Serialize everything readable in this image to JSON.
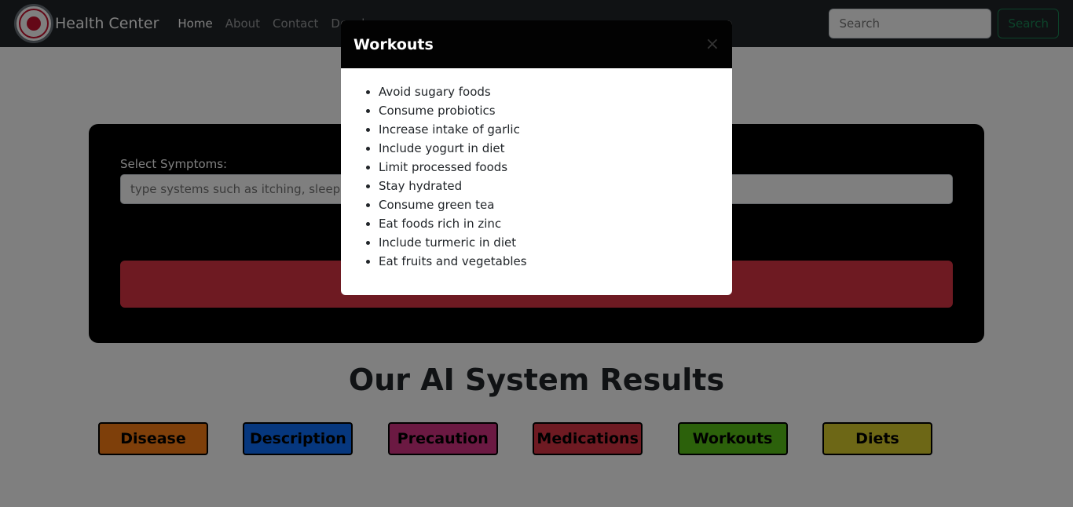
{
  "navbar": {
    "brand": "Health Center",
    "links": [
      {
        "label": "Home",
        "active": true
      },
      {
        "label": "About",
        "active": false
      },
      {
        "label": "Contact",
        "active": false
      },
      {
        "label": "Devel",
        "active": false
      }
    ],
    "search_placeholder": "Search",
    "search_button": "Search"
  },
  "form": {
    "label": "Select Symptoms:",
    "placeholder": "type systems such as itching, sleeping,"
  },
  "results": {
    "title": "Our AI System Results",
    "buttons": [
      {
        "label": "Disease",
        "color": "#fd7e14"
      },
      {
        "label": "Description",
        "color": "#0d6efd"
      },
      {
        "label": "Precaution",
        "color": "#d63384"
      },
      {
        "label": "Medications",
        "color": "#dc3545"
      },
      {
        "label": "Workouts",
        "color": "#58c217"
      },
      {
        "label": "Diets",
        "color": "#dbcf2c"
      }
    ]
  },
  "modal": {
    "title": "Workouts",
    "close_icon": "close-icon",
    "items": [
      "Avoid sugary foods",
      "Consume probiotics",
      "Increase intake of garlic",
      "Include yogurt in diet",
      "Limit processed foods",
      "Stay hydrated",
      "Consume green tea",
      "Eat foods rich in zinc",
      "Include turmeric in diet",
      "Eat fruits and vegetables"
    ]
  }
}
